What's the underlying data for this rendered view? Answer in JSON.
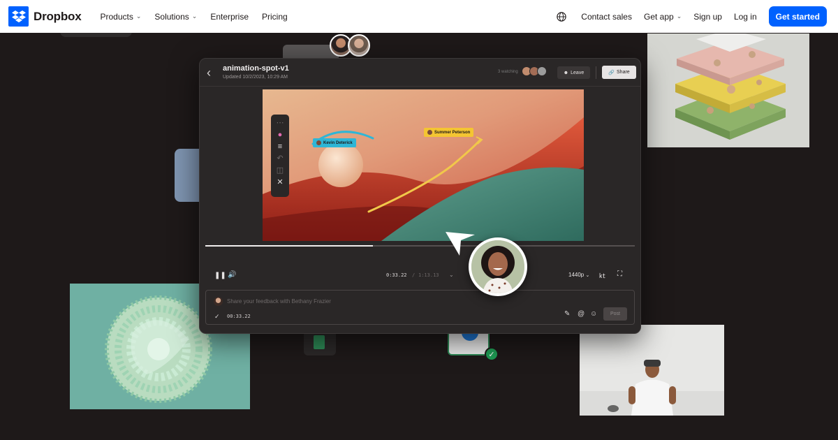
{
  "nav": {
    "brand": "Dropbox",
    "items": [
      {
        "label": "Products",
        "has_chevron": true
      },
      {
        "label": "Solutions",
        "has_chevron": true
      },
      {
        "label": "Enterprise",
        "has_chevron": false
      },
      {
        "label": "Pricing",
        "has_chevron": false
      }
    ],
    "right_items": [
      {
        "label": "Contact sales",
        "has_chevron": false
      },
      {
        "label": "Get app",
        "has_chevron": true
      },
      {
        "label": "Sign up",
        "has_chevron": false
      },
      {
        "label": "Log in",
        "has_chevron": false
      }
    ],
    "cta": "Get started",
    "icons": [
      "dropbox-logo-icon",
      "globe-icon",
      "chevron-down-icon"
    ]
  },
  "player": {
    "title": "animation-spot-v1",
    "subtitle": "Updated 10/2/2023, 10:29 AM",
    "watching": "3 watching",
    "leave_label": "Leave",
    "share_label": "Share",
    "annotations": {
      "kevin": "Kevin Deterick",
      "summer": "Summer Peterson"
    },
    "progress": 0.39,
    "time_current": "0:33.22",
    "time_separator": "/",
    "time_total": "1:13.13",
    "quality": "1440p",
    "comment_placeholder": "Share your feedback with Bethany Frazier",
    "comment_timestamp": "00:33.22",
    "post_label": "Post"
  },
  "colors": {
    "brand": "#0061fe",
    "background": "#1e1919",
    "annotation_blue": "#2fb6d6",
    "annotation_yellow": "#f4c532",
    "success": "#1f9d55"
  }
}
